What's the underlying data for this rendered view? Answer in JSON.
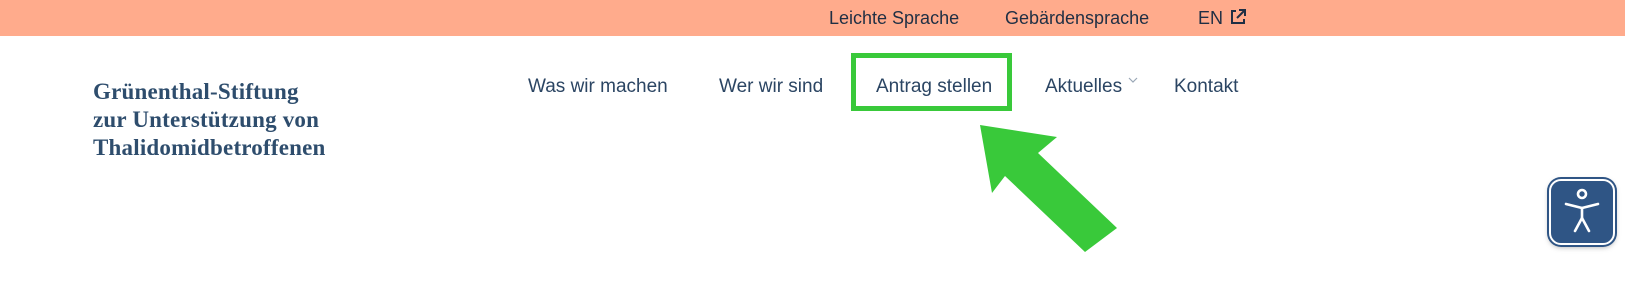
{
  "topbar": {
    "leichte_sprache": "Leichte Sprache",
    "gebaerdensprache": "Gebärdensprache",
    "language": "EN",
    "language_icon": "external-link-icon",
    "background": "#ffab8c"
  },
  "logo": {
    "line1": "Grünenthal-Stiftung",
    "line2": "zur Unterstützung von",
    "line3": "Thalidomidbetroffenen",
    "color": "#2e4d6d"
  },
  "nav": {
    "items": [
      {
        "label": "Was wir machen"
      },
      {
        "label": "Wer wir sind"
      },
      {
        "label": "Antrag stellen",
        "highlighted": true
      },
      {
        "label": "Aktuelles",
        "has_submenu": true,
        "submenu_icon": "chevron-down-icon"
      },
      {
        "label": "Kontakt"
      }
    ]
  },
  "annotation": {
    "highlight_color": "#39c93a",
    "arrow_icon": "arrow-pointer-icon"
  },
  "accessibility_button": {
    "icon": "accessibility-person-icon",
    "color": "#2f5585"
  }
}
